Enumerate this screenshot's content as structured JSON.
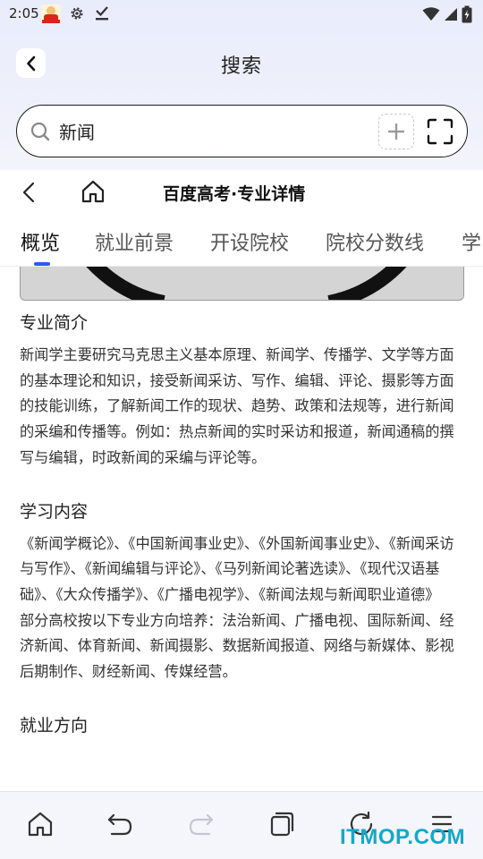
{
  "status_bar": {
    "time": "2:05"
  },
  "header": {
    "title": "搜索"
  },
  "search": {
    "query": "新闻"
  },
  "web": {
    "title": "百度高考·专业详情",
    "tabs": [
      {
        "label": "概览"
      },
      {
        "label": "就业前景"
      },
      {
        "label": "开设院校"
      },
      {
        "label": "院校分数线"
      },
      {
        "label": "学"
      }
    ]
  },
  "content": {
    "intro_heading": "专业简介",
    "intro_text": "新闻学主要研究马克思主义基本原理、新闻学、传播学、文学等方面的基本理论和知识，接受新闻采访、写作、编辑、评论、摄影等方面的技能训练，了解新闻工作的现状、趋势、政策和法规等，进行新闻的采编和传播等。例如：热点新闻的实时采访和报道，新闻通稿的撰写与编辑，时政新闻的采编与评论等。",
    "study_heading": "学习内容",
    "study_courses": "《新闻学概论》、《中国新闻事业史》、《外国新闻事业史》、《新闻采访与写作》、《新闻编辑与评论》、《马列新闻论著选读》、《现代汉语基础》、《大众传播学》、《广播电视学》、《新闻法规与新闻职业道德》",
    "study_directions": "部分高校按以下专业方向培养：法治新闻、广播电视、国际新闻、经济新闻、体育新闻、新闻摄影、数据新闻报道、网络与新媒体、影视后期制作、财经新闻、传媒经营。",
    "career_heading": "就业方向"
  },
  "bottom_bar": {
    "icons": [
      "home-icon",
      "undo-icon",
      "redo-icon",
      "tabs-icon",
      "refresh-icon",
      "menu-icon"
    ]
  },
  "watermark": "ITMOP.COM",
  "colors": {
    "accent": "#2a5bf0",
    "watermark": "#14a9c9"
  }
}
